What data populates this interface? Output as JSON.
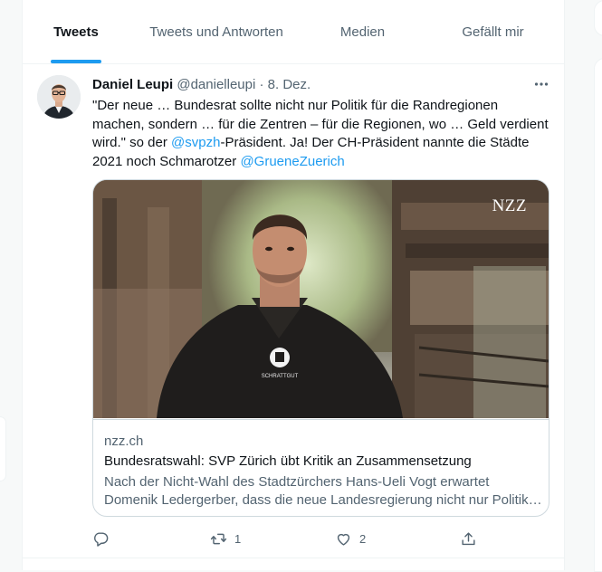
{
  "tabs": [
    {
      "label": "Tweets",
      "active": true
    },
    {
      "label": "Tweets und Antworten",
      "active": false
    },
    {
      "label": "Medien",
      "active": false
    },
    {
      "label": "Gefällt mir",
      "active": false
    }
  ],
  "tweet": {
    "author_name": "Daniel Leupi",
    "handle": "@danielleupi",
    "separator": "·",
    "date": "8. Dez.",
    "more_icon": "more-horizontal-icon",
    "text": {
      "part1": "\"Der neue … Bundesrat sollte nicht nur Politik für die Randregionen machen, sondern … für die Zentren – für die Regionen, wo … Geld verdient wird.\" so der ",
      "mention1": "@svpzh",
      "part2": "-Präsident. Ja! Der CH-Präsident nannte die Städte 2021 noch Schmarotzer ",
      "mention2": "@GrueneZuerich"
    },
    "card": {
      "image_logo": "NZZ",
      "image_apparel_text": "SCHRATTGUT",
      "domain": "nzz.ch",
      "title": "Bundesratswahl: SVP Zürich übt Kritik an Zusammensetzung",
      "description": "Nach der Nicht-Wahl des Stadtzürchers Hans-Ueli Vogt erwartet Domenik Ledergerber, dass die neue Landesregierung nicht nur Politik …"
    },
    "actions": {
      "reply_count": "",
      "retweet_count": "1",
      "like_count": "2"
    }
  },
  "colors": {
    "accent": "#1d9bf0",
    "text": "#0f1419",
    "muted": "#536471",
    "border": "#eff3f4"
  }
}
